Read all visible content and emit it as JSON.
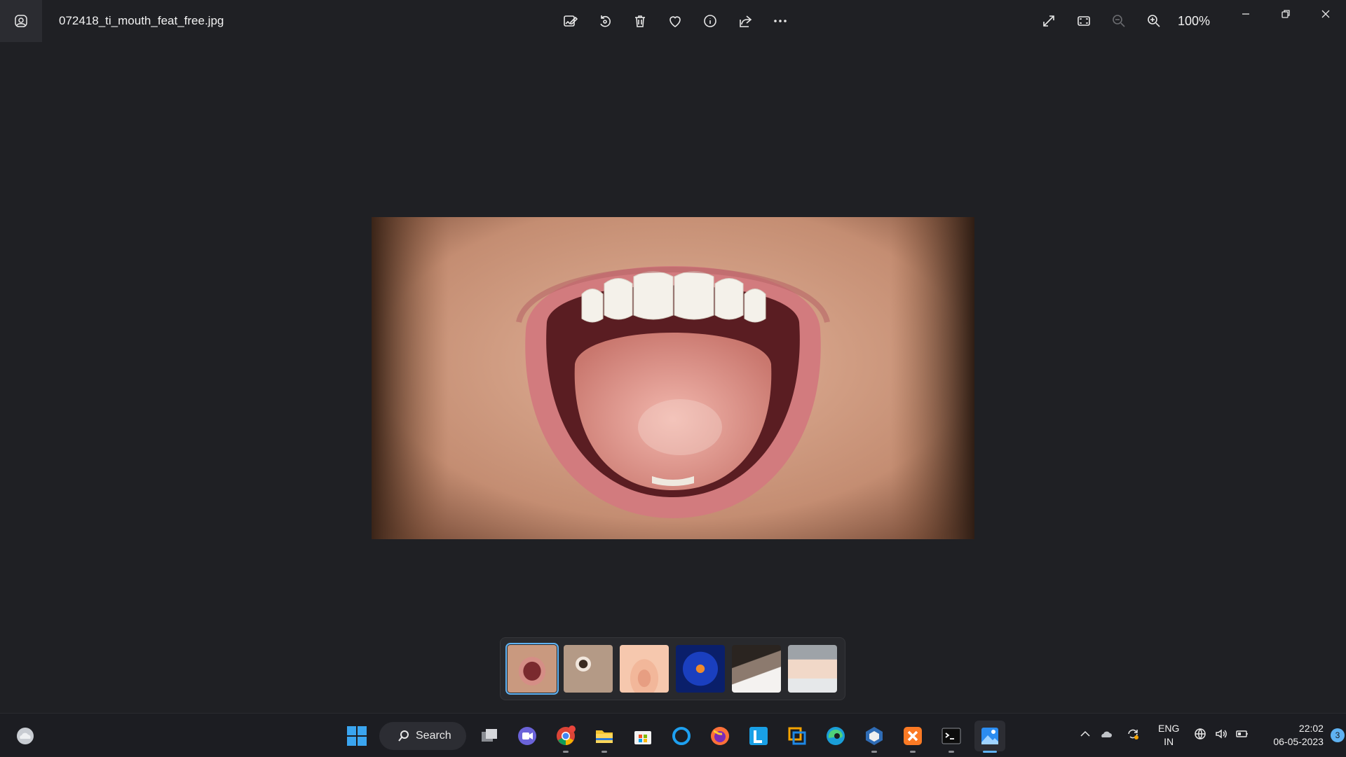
{
  "window": {
    "filename": "072418_ti_mouth_feat_free.jpg",
    "zoom_level": "100%"
  },
  "toolbar": {
    "center": [
      {
        "name": "edit-image-icon"
      },
      {
        "name": "rotate-icon"
      },
      {
        "name": "delete-icon"
      },
      {
        "name": "favorite-heart-icon"
      },
      {
        "name": "info-icon"
      },
      {
        "name": "share-icon"
      },
      {
        "name": "more-options-icon"
      }
    ],
    "right": [
      {
        "name": "full-screen-icon"
      },
      {
        "name": "fit-to-window-icon"
      },
      {
        "name": "zoom-out-icon"
      },
      {
        "name": "zoom-in-icon"
      }
    ]
  },
  "filmstrip": {
    "thumbnails": [
      {
        "name": "thumbnail-mouth",
        "selected": true
      },
      {
        "name": "thumbnail-eye",
        "selected": false
      },
      {
        "name": "thumbnail-nose",
        "selected": false
      },
      {
        "name": "thumbnail-joints",
        "selected": false
      },
      {
        "name": "thumbnail-hair",
        "selected": false
      },
      {
        "name": "thumbnail-face-treatment",
        "selected": false
      }
    ]
  },
  "taskbar": {
    "search_label": "Search",
    "language_line1": "ENG",
    "language_line2": "IN",
    "time": "22:02",
    "date": "06-05-2023",
    "notification_count": "3",
    "apps": [
      "weather",
      "start",
      "search",
      "task-view",
      "teams-chat",
      "chrome",
      "file-explorer",
      "microsoft-store",
      "cortana",
      "firefox",
      "l-app",
      "snipping-tool",
      "edge",
      "virtualbox",
      "xampp",
      "terminal",
      "photos"
    ]
  },
  "colors": {
    "background": "#1f2024",
    "accent": "#5fb2f2",
    "taskbar": "#1c1d22"
  }
}
